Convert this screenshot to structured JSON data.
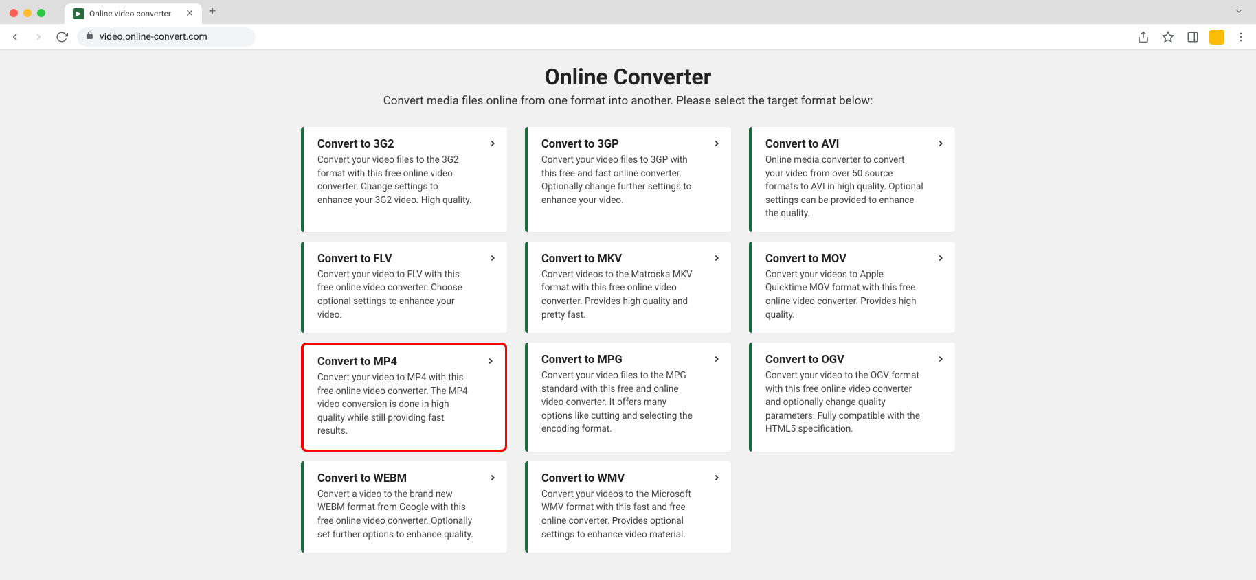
{
  "browser": {
    "tab_title": "Online video converter",
    "url": "video.online-convert.com"
  },
  "page": {
    "title": "Online Converter",
    "subtitle": "Convert media files online from one format into another. Please select the target format below:"
  },
  "cards": [
    {
      "title": "Convert to 3G2",
      "desc": "Convert your video files to the 3G2 format with this free online video converter. Change settings to enhance your 3G2 video. High quality.",
      "highlighted": false
    },
    {
      "title": "Convert to 3GP",
      "desc": "Convert your video files to 3GP with this free and fast online converter. Optionally change further settings to enhance your video.",
      "highlighted": false
    },
    {
      "title": "Convert to AVI",
      "desc": "Online media converter to convert your video from over 50 source formats to AVI in high quality. Optional settings can be provided to enhance the quality.",
      "highlighted": false
    },
    {
      "title": "Convert to FLV",
      "desc": "Convert your video to FLV with this free online video converter. Choose optional settings to enhance your video.",
      "highlighted": false
    },
    {
      "title": "Convert to MKV",
      "desc": "Convert videos to the Matroska MKV format with this free online video converter. Provides high quality and pretty fast.",
      "highlighted": false
    },
    {
      "title": "Convert to MOV",
      "desc": "Convert your videos to Apple Quicktime MOV format with this free online video converter. Provides high quality.",
      "highlighted": false
    },
    {
      "title": "Convert to MP4",
      "desc": "Convert your video to MP4 with this free online video converter. The MP4 video conversion is done in high quality while still providing fast results.",
      "highlighted": true
    },
    {
      "title": "Convert to MPG",
      "desc": "Convert your video files to the MPG standard with this free and online video converter. It offers many options like cutting and selecting the encoding format.",
      "highlighted": false
    },
    {
      "title": "Convert to OGV",
      "desc": "Convert your video to the OGV format with this free online video converter and optionally change quality parameters. Fully compatible with the HTML5 specification.",
      "highlighted": false
    },
    {
      "title": "Convert to WEBM",
      "desc": "Convert a video to the brand new WEBM format from Google with this free online video converter. Optionally set further options to enhance quality.",
      "highlighted": false
    },
    {
      "title": "Convert to WMV",
      "desc": "Convert your videos to the Microsoft WMV format with this fast and free online converter. Provides optional settings to enhance video material.",
      "highlighted": false
    }
  ]
}
